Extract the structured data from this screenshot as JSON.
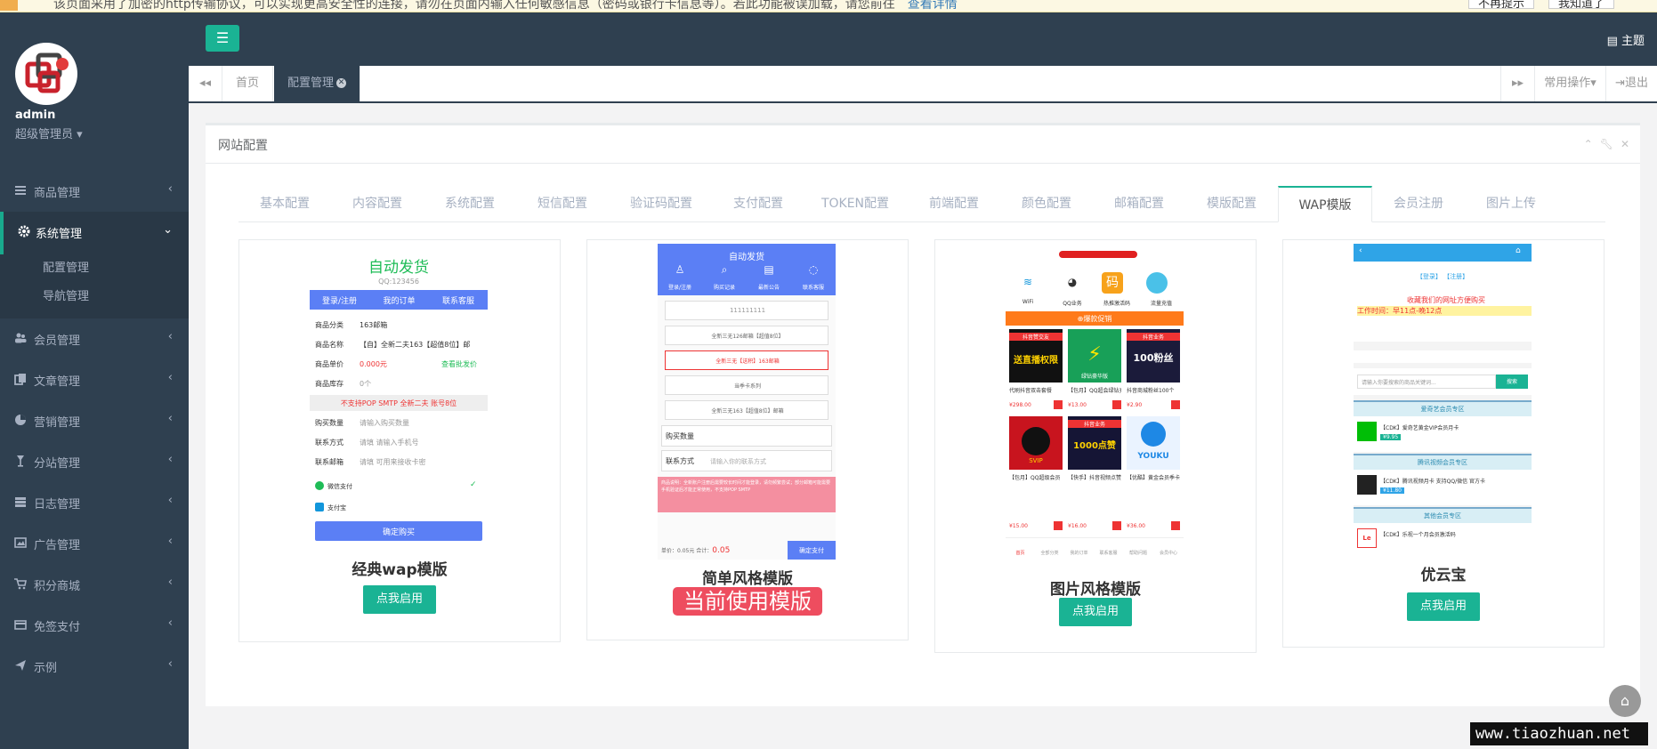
{
  "notice": {
    "text": "该页面采用了加密的http传输协议，可以实现更高安全性的连接，请勿在页面内输入任何敏感信息（密码或银行卡信息等）。若此功能被误加载，请您前往",
    "link": "查看详情",
    "btn1": "不再提示",
    "btn2": "我知道了"
  },
  "user": {
    "name": "admin",
    "role": "超级管理员"
  },
  "menu": [
    {
      "label": "商品管理",
      "icon": "list-icon"
    },
    {
      "label": "系统管理",
      "icon": "gear-icon",
      "open": true,
      "children": [
        "配置管理",
        "导航管理"
      ]
    },
    {
      "label": "会员管理",
      "icon": "users-icon"
    },
    {
      "label": "文章管理",
      "icon": "files-icon"
    },
    {
      "label": "营销管理",
      "icon": "pie-chart-icon"
    },
    {
      "label": "分站管理",
      "icon": "glass-icon"
    },
    {
      "label": "日志管理",
      "icon": "log-icon"
    },
    {
      "label": "广告管理",
      "icon": "picture-icon"
    },
    {
      "label": "积分商城",
      "icon": "cart-icon"
    },
    {
      "label": "免签支付",
      "icon": "credit-card-icon"
    },
    {
      "label": "示例",
      "icon": "paper-plane-icon"
    }
  ],
  "topbar": {
    "theme": "主题"
  },
  "pageTabs": {
    "home": "首页",
    "current": "配置管理",
    "ops": "常用操作",
    "logout": "退出"
  },
  "panel": {
    "title": "网站配置"
  },
  "configTabs": [
    "基本配置",
    "内容配置",
    "系统配置",
    "短信配置",
    "验证码配置",
    "支付配置",
    "TOKEN配置",
    "前端配置",
    "颜色配置",
    "邮箱配置",
    "模版配置",
    "WAP模版",
    "会员注册",
    "图片上传"
  ],
  "activeTab": "WAP模版",
  "templates": [
    {
      "name": "经典wap模版",
      "button": "点我启用"
    },
    {
      "name": "简单风格模版",
      "current": "当前使用模版"
    },
    {
      "name": "图片风格模版",
      "button": "点我启用"
    },
    {
      "name": "优云宝",
      "button": "点我启用"
    }
  ],
  "preview1": {
    "title": "自动发货",
    "qq": "QQ:123456",
    "nav": [
      "登录/注册",
      "我的订单",
      "联系客服"
    ],
    "rows": [
      [
        "商品分类",
        "163邮箱"
      ],
      [
        "商品名称",
        "【自】全新二夫163【超值8位】邮"
      ],
      [
        "商品单价",
        "0.000元"
      ],
      [
        "商品库存",
        "0个"
      ]
    ],
    "stock": "查看批发价",
    "notice": "不支持POP SMTP 全新二夫 账号8位",
    "fields": [
      [
        "购买数量",
        "请输入购买数量"
      ],
      [
        "联系方式",
        "请填 请输入手机号"
      ],
      [
        "联系邮箱",
        "请填 可用来接收卡密"
      ]
    ],
    "pay1": "微信支付",
    "pay2": "支付宝",
    "buy": "确定购买"
  },
  "preview2": {
    "title": "自动发货",
    "icons": [
      "登录/注册",
      "购买记录",
      "最新公告",
      "联系客服"
    ],
    "input": "111111111",
    "items": [
      "全新三无126邮箱【超值8位】",
      "全新三无【送积】163邮箱",
      "当季卡系列",
      "全新三无163【超值8位】邮箱"
    ],
    "qty": "购买数量",
    "contact": "联系方式",
    "contactPh": "请输入你的联系方式",
    "warn": "商品说明：全新账户注册后需要较长时间才能登录，请勿频繁尝试；部分邮箱可能需要手机验证后才能正常使用，不支持POP SMTP",
    "total": "单价：0.05元 合计：",
    "price": "0.05",
    "buy": "确定支付"
  },
  "preview3": {
    "icons": [
      "WiFi",
      "QQ业务",
      "热推激活码",
      "流量充值"
    ],
    "banner": "⊕爆款促销",
    "products": [
      {
        "name": "代刷抖音双击套餐",
        "price": "¥298.00",
        "tag": "抖音赞交友",
        "big": "送直播权限"
      },
      {
        "name": "【包月】QQ超会绿钻充值",
        "price": "¥13.00",
        "tag": "绿钻豪华版",
        "big": "绿钻"
      },
      {
        "name": "抖音商城粉丝100个",
        "price": "¥2.90",
        "tag": "抖音业务",
        "big": "100粉丝"
      },
      {
        "name": "【包月】QQ超级会员",
        "price": "¥15.00",
        "tag": "QQ",
        "big": "SVIP"
      },
      {
        "name": "【快手】抖音视频点赞1000个",
        "price": "¥16.00",
        "tag": "抖音业务",
        "big": "1000点赞"
      },
      {
        "name": "【优酷】黄金会员季卡",
        "price": "¥36.00",
        "tag": "YOUKU",
        "big": "优酷"
      }
    ],
    "footer": [
      "首页",
      "全部分类",
      "我的订单",
      "联系客服",
      "帮助问题",
      "会员中心"
    ]
  },
  "preview4": {
    "links": "【登录】 【注册】",
    "marquee": "收藏我们的网址方便购买",
    "hours": "工作时间：早11点-晚12点",
    "search": "请输入你要搜索的商品关键词...",
    "searchBtn": "搜索",
    "sections": [
      {
        "title": "爱奇艺会员专区",
        "item": "【CDK】爱奇艺黄金VIP会员月卡",
        "price": "¥9.95"
      },
      {
        "title": "腾讯视频会员专区",
        "item": "【CDK】腾讯视频月卡 支持QQ/微信 官方卡",
        "price": "¥11.80"
      },
      {
        "title": "其他会员专区",
        "item": "【CDK】乐视一个月会员激活码",
        "price": ""
      }
    ]
  },
  "watermark": "www.tiaozhuan.net",
  "colors": {
    "sidebar": "#2f4050",
    "accent": "#1ab394",
    "danger": "#ee4d5f",
    "blue": "#5b7ff5"
  }
}
